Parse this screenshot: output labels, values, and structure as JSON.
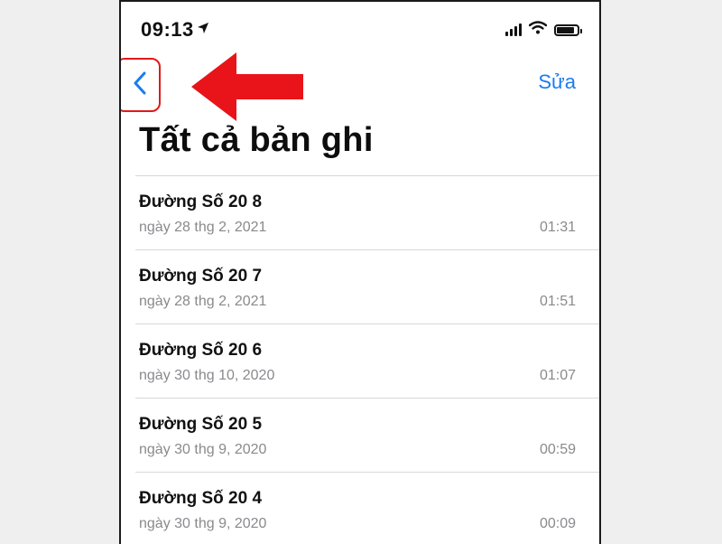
{
  "status_bar": {
    "time": "09:13",
    "icons": [
      "location-arrow-icon",
      "signal-icon",
      "wifi-icon",
      "battery-icon"
    ]
  },
  "nav": {
    "back_icon": "chevron-left-icon",
    "edit_label": "Sửa",
    "accent_color": "#1a7cf0",
    "annotation_color": "#e01a1a"
  },
  "page": {
    "title": "Tất cả bản ghi"
  },
  "recordings": [
    {
      "name": "Đường Số 20 8",
      "date": "ngày 28 thg 2, 2021",
      "duration": "01:31"
    },
    {
      "name": "Đường Số 20 7",
      "date": "ngày 28 thg 2, 2021",
      "duration": "01:51"
    },
    {
      "name": "Đường Số 20 6",
      "date": "ngày 30 thg 10, 2020",
      "duration": "01:07"
    },
    {
      "name": "Đường Số 20 5",
      "date": "ngày 30 thg 9, 2020",
      "duration": "00:59"
    },
    {
      "name": "Đường Số 20 4",
      "date": "ngày 30 thg 9, 2020",
      "duration": "00:09"
    }
  ]
}
